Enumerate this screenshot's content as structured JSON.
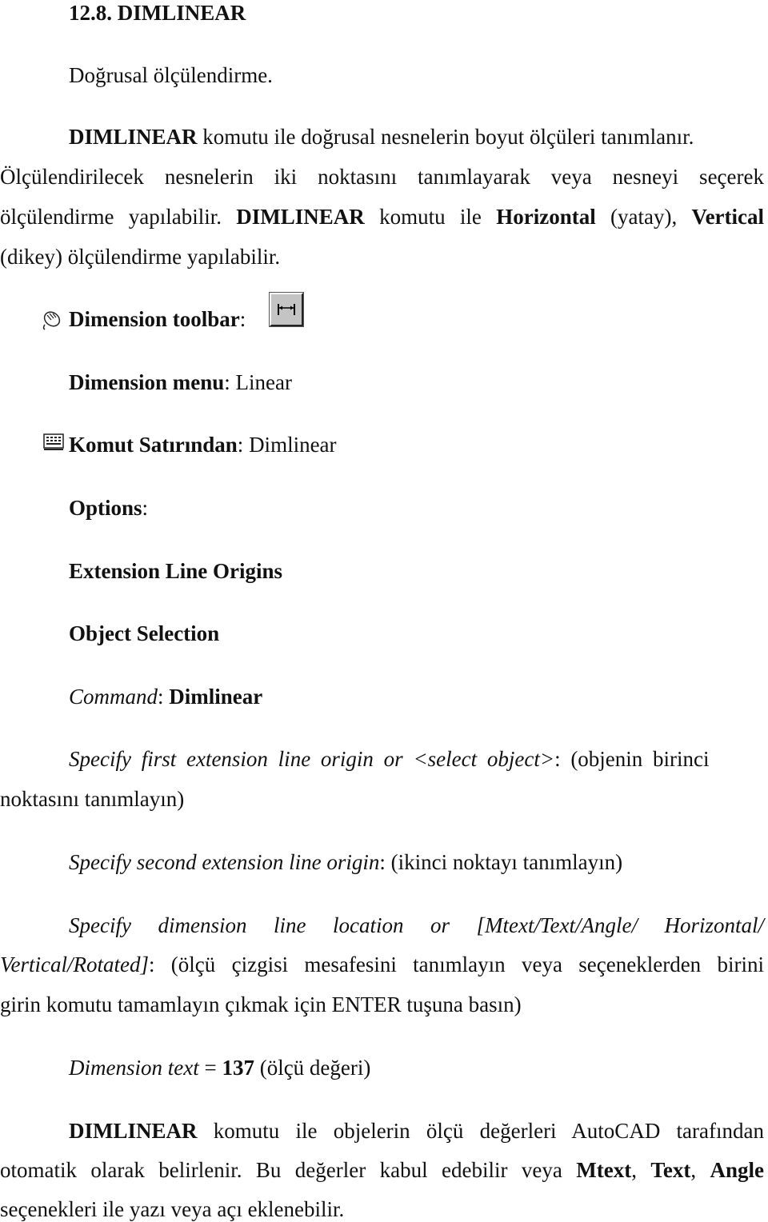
{
  "heading": "12.8. DIMLINEAR",
  "subtitle": "Doğrusal ölçülendirme.",
  "intro": {
    "cmd": "DIMLINEAR",
    "line1_rest": " komutu ile doğrusal nesnelerin boyut ölçüleri tanımlanır.",
    "line2": "Ölçülendirilecek nesnelerin iki noktasını tanımlayarak veya nesneyi seçerek",
    "line3_a": "ölçülendirme yapılabilir. ",
    "line3_cmd": "DIMLINEAR",
    "line3_b": " komutu ile ",
    "line3_h": "Horizontal",
    "line3_c": " (yatay), ",
    "line3_v": "Vertical",
    "line4": "(dikey) ölçülendirme yapılabilir."
  },
  "toolbar": {
    "label": "Dimension toolbar",
    "colon": ":",
    "icon": "linear-dimension-icon"
  },
  "menu": {
    "label": "Dimension menu",
    "colon": ": ",
    "value": "Linear"
  },
  "cmdline": {
    "label": "Komut Satırından",
    "colon": ": ",
    "value": "Dimlinear",
    "icon": "keyboard-icon"
  },
  "options": {
    "label": "Options",
    "colon": ":",
    "items": [
      "Extension Line Origins",
      "Object Selection"
    ]
  },
  "command": {
    "label": "Command",
    "colon": ": ",
    "value": "Dimlinear"
  },
  "prompts": {
    "p1_italic": "Specify first extension line origin or <select object>",
    "p1_rest": ": (objenin birinci",
    "p1_line2": "noktasını tanımlayın)",
    "p2_italic": "Specify second extension line origin",
    "p2_rest": ": (ikinci noktayı tanımlayın)",
    "p3_line1": "Specify dimension line location or [Mtext/Text/Angle/ Horizontal/",
    "p3_line2_italic": "Vertical/Rotated]",
    "p3_line2_rest": ": (ölçü çizgisi mesafesini tanımlayın veya seçeneklerden birini",
    "p3_line3": "girin komutu tamamlayın çıkmak için ENTER tuşuna basın)"
  },
  "dimtext": {
    "label": "Dimension text",
    "eq": " = ",
    "value": "137",
    "note": " (ölçü değeri)"
  },
  "closing": {
    "cmd": "DIMLINEAR",
    "line1_rest": " komutu ile objelerin ölçü değerleri AutoCAD tarafından",
    "line2_a": "otomatik olarak belirlenir. Bu değerler kabul edebilir veya ",
    "opt1": "Mtext",
    "sep1": ", ",
    "opt2": "Text",
    "sep2": ", ",
    "opt3": "Angle",
    "line3": "seçenekleri ile yazı veya açı eklenebilir."
  }
}
